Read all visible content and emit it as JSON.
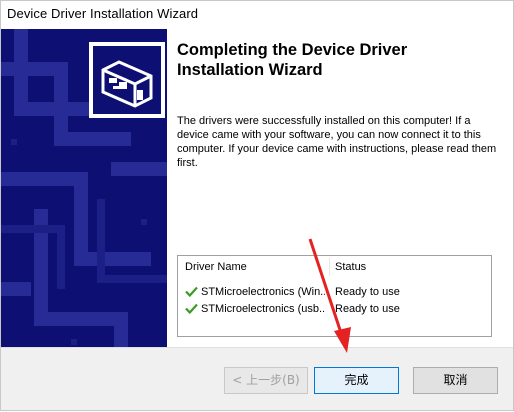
{
  "window": {
    "title": "Device Driver Installation Wizard"
  },
  "page": {
    "heading": "Completing the Device Driver Installation Wizard",
    "message": "The drivers were successfully installed on this computer! If a device came with your software, you can now connect it to this computer. If your device came with instructions, please read them first."
  },
  "driver_list": {
    "columns": [
      "Driver Name",
      "Status"
    ],
    "rows": [
      {
        "name": "STMicroelectronics (Win...",
        "status": "Ready to use",
        "icon": "green-check-icon"
      },
      {
        "name": "STMicroelectronics (usb...",
        "status": "Ready to use",
        "icon": "green-check-icon"
      }
    ]
  },
  "buttons": {
    "back": "< 上一步(B)",
    "finish": "完成",
    "cancel": "取消"
  },
  "colors": {
    "banner": "#0d0f73",
    "check": "#3a9d23",
    "annotation_arrow": "#e52222",
    "focus_border": "#0078d7"
  }
}
